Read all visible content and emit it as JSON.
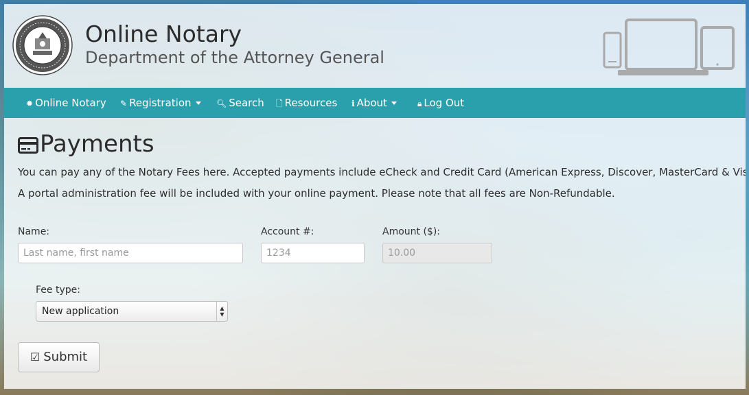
{
  "header": {
    "title": "Online Notary",
    "subtitle": "Department of the Attorney General",
    "seal_top_text": "ATTORNEY GENERAL",
    "seal_bottom_text": "STATE OF HAWAII"
  },
  "nav": {
    "items": [
      {
        "label": "Online Notary",
        "icon": "gear-icon"
      },
      {
        "label": "Registration",
        "icon": "edit-icon",
        "dropdown": true
      },
      {
        "label": "Search",
        "icon": "search-icon"
      },
      {
        "label": "Resources",
        "icon": "file-icon"
      },
      {
        "label": "About",
        "icon": "info-icon",
        "dropdown": true
      },
      {
        "label": "Log Out",
        "icon": "lock-icon"
      }
    ]
  },
  "page": {
    "title": "Payments",
    "title_icon": "credit-card-icon",
    "intro1": "You can pay any of the Notary Fees here. Accepted payments include eCheck and Credit Card (American Express, Discover, MasterCard & Visa).",
    "intro2": "A portal administration fee will be included with your online payment. Please note that all fees are Non-Refundable."
  },
  "form": {
    "name_label": "Name:",
    "name_placeholder": "Last name, first name",
    "account_label": "Account #:",
    "account_placeholder": "1234",
    "amount_label": "Amount ($):",
    "amount_placeholder": "10.00",
    "fee_type_label": "Fee type:",
    "fee_type_selected": "New application",
    "submit_label": "Submit"
  },
  "colors": {
    "navbar": "#2aa0ad",
    "nav_text": "#ffffff"
  }
}
